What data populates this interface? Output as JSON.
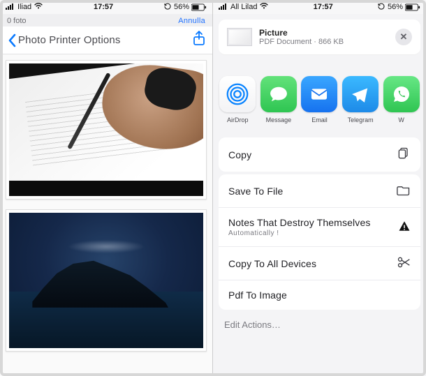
{
  "status_left": {
    "carrier_prefix": "",
    "carrier": "Iliad",
    "wifi_icon": "wifi-icon"
  },
  "status_left_right_pane": {
    "carrier_prefix": "All",
    "carrier": "Lilad"
  },
  "status_time": "17:57",
  "status_right": {
    "reload_icon": "refresh-icon",
    "battery_pct": "56%",
    "battery_icon": "battery-icon"
  },
  "left": {
    "secondary_title": "0 foto",
    "secondary_action": "Annulla",
    "back_label": "Photo Printer Options"
  },
  "share_doc": {
    "title": "Picture",
    "subtitle": "PDF Document · 866 KB"
  },
  "apps": [
    {
      "name": "airdrop",
      "label": "AirDrop"
    },
    {
      "name": "messages",
      "label": "Message"
    },
    {
      "name": "mail",
      "label": "Email"
    },
    {
      "name": "telegram",
      "label": "Telegram"
    },
    {
      "name": "whatsapp",
      "label": "W"
    }
  ],
  "actions": {
    "copy": "Copy",
    "save_to_file": "Save To File",
    "notes_line1": "Notes That Destroy Themselves",
    "notes_line2": "Automatically !",
    "copy_all": "Copy To All Devices",
    "pdf_to_image": "Pdf To Image",
    "edit": "Edit Actions…"
  }
}
